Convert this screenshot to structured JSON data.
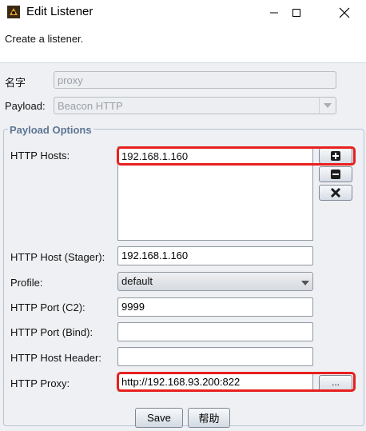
{
  "window": {
    "title": "Edit Listener",
    "controls": [
      "minimize",
      "maximize",
      "close"
    ]
  },
  "description": "Create a listener.",
  "form": {
    "name_label": "名字",
    "name_value": "proxy",
    "payload_label": "Payload:",
    "payload_value": "Beacon HTTP"
  },
  "payload_options": {
    "group_title": "Payload Options",
    "http_hosts_label": "HTTP Hosts:",
    "http_hosts": [
      "192.168.1.160"
    ],
    "host_buttons": [
      "add",
      "remove",
      "clear"
    ],
    "http_host_stager_label": "HTTP Host (Stager):",
    "http_host_stager_value": "192.168.1.160",
    "profile_label": "Profile:",
    "profile_value": "default",
    "http_port_c2_label": "HTTP Port (C2):",
    "http_port_c2_value": "9999",
    "http_port_bind_label": "HTTP Port (Bind):",
    "http_port_bind_value": "",
    "http_host_header_label": "HTTP Host Header:",
    "http_host_header_value": "",
    "http_proxy_label": "HTTP Proxy:",
    "http_proxy_value": "http://192.168.93.200:822",
    "proxy_browse_label": "..."
  },
  "buttons": {
    "save": "Save",
    "help": "帮助"
  },
  "colors": {
    "highlight": "#e8201e",
    "group_title": "#5e7594"
  }
}
